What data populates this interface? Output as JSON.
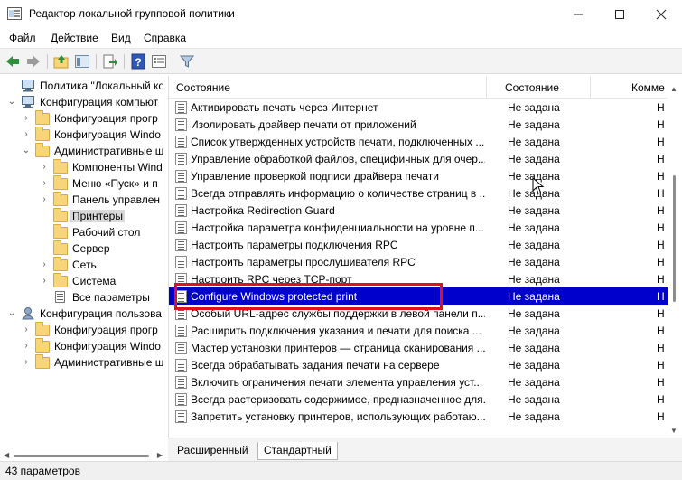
{
  "window": {
    "title": "Редактор локальной групповой политики",
    "buttons": [
      "minimize",
      "maximize",
      "close"
    ]
  },
  "menu": [
    "Файл",
    "Действие",
    "Вид",
    "Справка"
  ],
  "toolbar": {
    "icons": [
      "back-arrow-icon",
      "forward-arrow-icon",
      "up-folder-icon",
      "show-hide-tree-icon",
      "export-list-icon",
      "help-icon",
      "properties-icon",
      "filter-icon"
    ]
  },
  "tree": [
    {
      "label": "Политика \"Локальный комп",
      "level": 0,
      "arrow": "",
      "icon": "computer-policy-icon"
    },
    {
      "label": "Конфигурация компьют",
      "level": 0,
      "arrow": "v",
      "icon": "computer-icon"
    },
    {
      "label": "Конфигурация прогр",
      "level": 1,
      "arrow": ">",
      "icon": "folder-icon"
    },
    {
      "label": "Конфигурация Windo",
      "level": 1,
      "arrow": ">",
      "icon": "folder-icon"
    },
    {
      "label": "Административные ш",
      "level": 1,
      "arrow": "v",
      "icon": "folder-icon"
    },
    {
      "label": "Компоненты Wind",
      "level": 2,
      "arrow": ">",
      "icon": "folder-icon"
    },
    {
      "label": "Меню «Пуск» и п",
      "level": 2,
      "arrow": ">",
      "icon": "folder-icon"
    },
    {
      "label": "Панель управлен",
      "level": 2,
      "arrow": ">",
      "icon": "folder-icon"
    },
    {
      "label": "Принтеры",
      "level": 2,
      "arrow": "",
      "icon": "folder-icon",
      "selected": true
    },
    {
      "label": "Рабочий стол",
      "level": 2,
      "arrow": "",
      "icon": "folder-icon"
    },
    {
      "label": "Сервер",
      "level": 2,
      "arrow": "",
      "icon": "folder-icon"
    },
    {
      "label": "Сеть",
      "level": 2,
      "arrow": ">",
      "icon": "folder-icon"
    },
    {
      "label": "Система",
      "level": 2,
      "arrow": ">",
      "icon": "folder-icon"
    },
    {
      "label": "Все параметры",
      "level": 2,
      "arrow": "",
      "icon": "all-settings-icon"
    },
    {
      "label": "Конфигурация пользова",
      "level": 0,
      "arrow": "v",
      "icon": "user-icon"
    },
    {
      "label": "Конфигурация прогр",
      "level": 1,
      "arrow": ">",
      "icon": "folder-icon"
    },
    {
      "label": "Конфигурация Windo",
      "level": 1,
      "arrow": ">",
      "icon": "folder-icon"
    },
    {
      "label": "Административные ш",
      "level": 1,
      "arrow": ">",
      "icon": "folder-icon"
    }
  ],
  "columns": [
    "Состояние",
    "Состояние",
    "Комме"
  ],
  "rows": [
    {
      "name": "Активировать печать через Интернет",
      "state": "Не задана",
      "comment": "Н"
    },
    {
      "name": "Изолировать драйвер печати от приложений",
      "state": "Не задана",
      "comment": "Н"
    },
    {
      "name": "Список утвержденных устройств печати, подключенных ...",
      "state": "Не задана",
      "comment": "Н"
    },
    {
      "name": "Управление обработкой файлов, специфичных для очер...",
      "state": "Не задана",
      "comment": "Н"
    },
    {
      "name": "Управление проверкой подписи драйвера печати",
      "state": "Не задана",
      "comment": "Н"
    },
    {
      "name": "Всегда отправлять информацию о количестве страниц в ...",
      "state": "Не задана",
      "comment": "Н"
    },
    {
      "name": "Настройка Redirection Guard",
      "state": "Не задана",
      "comment": "Н"
    },
    {
      "name": "Настройка параметра конфиденциальности на уровне п...",
      "state": "Не задана",
      "comment": "Н"
    },
    {
      "name": "Настроить параметры подключения RPC",
      "state": "Не задана",
      "comment": "Н"
    },
    {
      "name": "Настроить параметры прослушивателя RPC",
      "state": "Не задана",
      "comment": "Н"
    },
    {
      "name": "Настроить RPC через TCP-порт",
      "state": "Не задана",
      "comment": "Н"
    },
    {
      "name": "Configure Windows protected print",
      "state": "Не задана",
      "comment": "Н",
      "selected": true
    },
    {
      "name": "Особый URL-адрес службы поддержки в левой панели п...",
      "state": "Не задана",
      "comment": "Н"
    },
    {
      "name": "Расширить подключения указания и печати для поиска ...",
      "state": "Не задана",
      "comment": "Н"
    },
    {
      "name": "Мастер установки принтеров — страница сканирования ...",
      "state": "Не задана",
      "comment": "Н"
    },
    {
      "name": "Всегда обрабатывать задания печати на сервере",
      "state": "Не задана",
      "comment": "Н"
    },
    {
      "name": "Включить ограничения печати элемента управления уст...",
      "state": "Не задана",
      "comment": "Н"
    },
    {
      "name": "Всегда растеризовать содержимое, предназначенное для...",
      "state": "Не задана",
      "comment": "Н"
    },
    {
      "name": "Запретить установку принтеров, использующих работаю...",
      "state": "Не задана",
      "comment": "Н"
    }
  ],
  "tabs": [
    "Расширенный",
    "Стандартный"
  ],
  "status": "43 параметров",
  "colors": {
    "selection": "#0000cc",
    "highlight_box": "#e0101c"
  }
}
